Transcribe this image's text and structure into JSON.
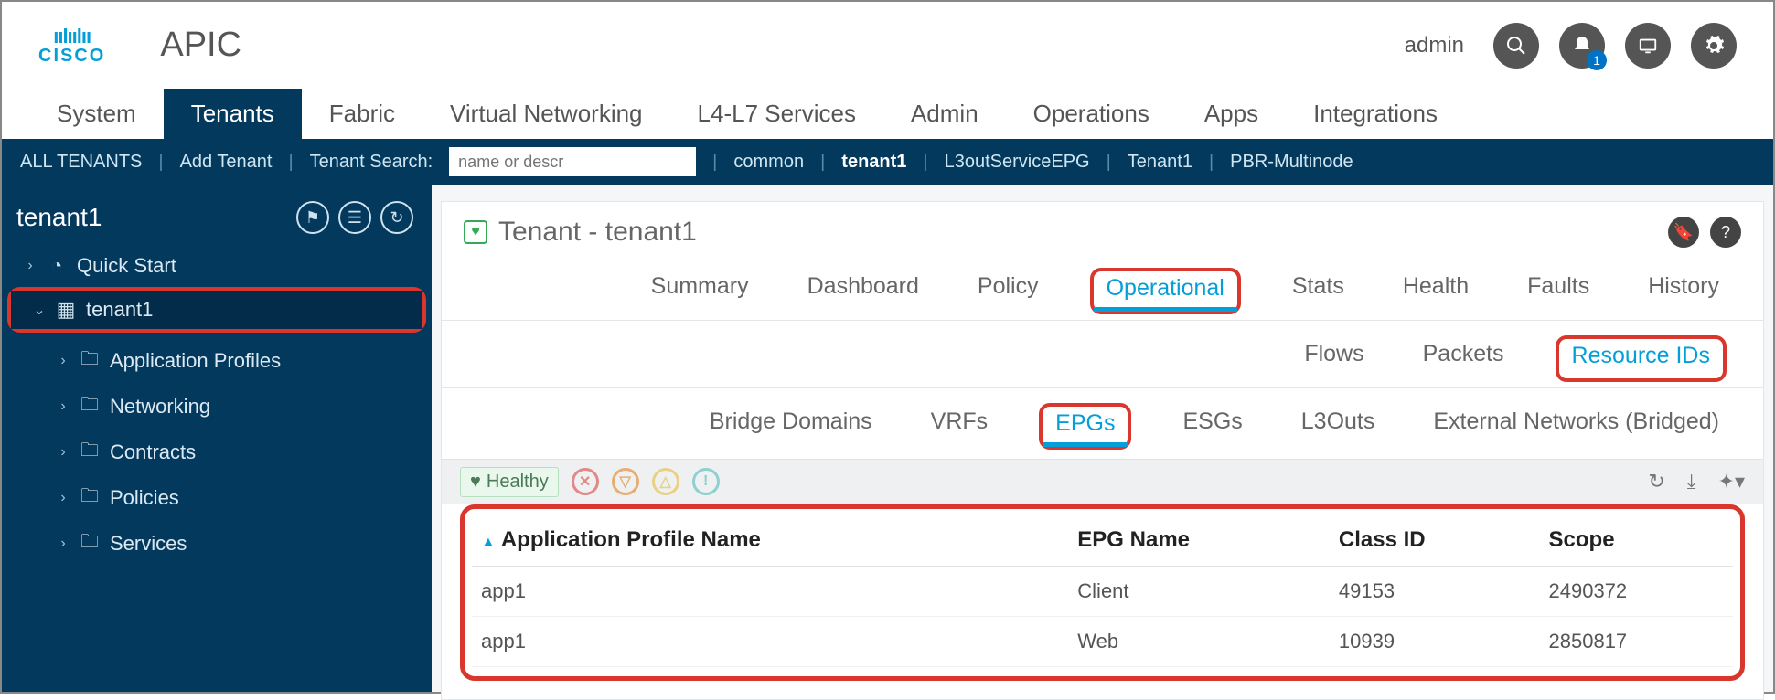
{
  "header": {
    "brand_top": "ıılıılıı",
    "brand_bottom": "CISCO",
    "product": "APIC",
    "user": "admin",
    "notif_badge": "1"
  },
  "primary_nav": [
    "System",
    "Tenants",
    "Fabric",
    "Virtual Networking",
    "L4-L7 Services",
    "Admin",
    "Operations",
    "Apps",
    "Integrations"
  ],
  "primary_nav_active": "Tenants",
  "secondary": {
    "all_tenants": "ALL TENANTS",
    "add_tenant": "Add Tenant",
    "search_label": "Tenant Search:",
    "search_placeholder": "name or descr",
    "links": [
      "common",
      "tenant1",
      "L3outServiceEPG",
      "Tenant1",
      "PBR-Multinode"
    ],
    "bold_link": "tenant1"
  },
  "sidebar": {
    "title": "tenant1",
    "items": [
      {
        "label": "Quick Start",
        "icon": "flag",
        "level": 1,
        "expandable": true
      },
      {
        "label": "tenant1",
        "icon": "grid",
        "level": 1,
        "expandable": true,
        "selected": true,
        "highlight": true,
        "open": true
      },
      {
        "label": "Application Profiles",
        "icon": "folder",
        "level": 2,
        "expandable": true
      },
      {
        "label": "Networking",
        "icon": "folder",
        "level": 2,
        "expandable": true
      },
      {
        "label": "Contracts",
        "icon": "folder",
        "level": 2,
        "expandable": true
      },
      {
        "label": "Policies",
        "icon": "folder",
        "level": 2,
        "expandable": true
      },
      {
        "label": "Services",
        "icon": "folder",
        "level": 2,
        "expandable": true
      }
    ]
  },
  "page": {
    "title": "Tenant - tenant1",
    "tabs1": [
      "Summary",
      "Dashboard",
      "Policy",
      "Operational",
      "Stats",
      "Health",
      "Faults",
      "History"
    ],
    "tabs1_active": "Operational",
    "tabs2": [
      "Flows",
      "Packets",
      "Resource IDs"
    ],
    "tabs2_active": "Resource IDs",
    "tabs3": [
      "Bridge Domains",
      "VRFs",
      "EPGs",
      "ESGs",
      "L3Outs",
      "External Networks (Bridged)"
    ],
    "tabs3_active": "EPGs",
    "healthy_label": "Healthy"
  },
  "table": {
    "columns": [
      "Application Profile Name",
      "EPG Name",
      "Class ID",
      "Scope"
    ],
    "rows": [
      {
        "app": "app1",
        "epg": "Client",
        "class_id": "49153",
        "scope": "2490372"
      },
      {
        "app": "app1",
        "epg": "Web",
        "class_id": "10939",
        "scope": "2850817"
      }
    ]
  }
}
